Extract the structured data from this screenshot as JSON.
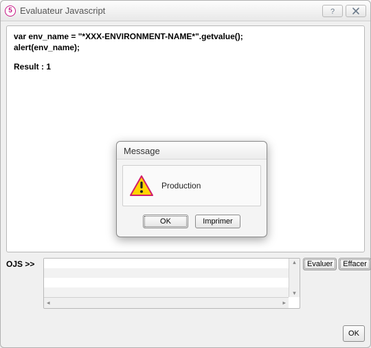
{
  "window": {
    "title": "Evaluateur Javascript",
    "app_icon_glyph": "5"
  },
  "output": {
    "line1": "var env_name = \"*XXX-ENVIRONMENT-NAME*\".getvalue();",
    "line2": "alert(env_name);",
    "result_label": "Result :",
    "result_value": "1"
  },
  "input": {
    "prompt_label": "OJS >>",
    "value": ""
  },
  "buttons": {
    "evaluer": "Evaluer",
    "effacer": "Effacer",
    "ok": "OK"
  },
  "dialog": {
    "title": "Message",
    "message": "Production",
    "ok": "OK",
    "imprimer": "Imprimer"
  }
}
